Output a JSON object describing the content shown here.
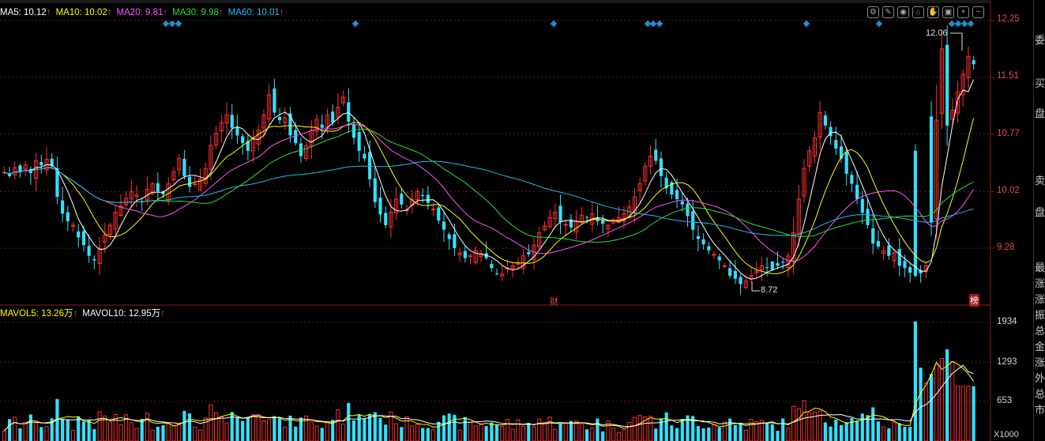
{
  "price_legend": [
    {
      "label": "MA5: 10.12",
      "color": "#ffffff"
    },
    {
      "label": "MA10: 10.02",
      "color": "#ffff00"
    },
    {
      "label": "MA20: 9.81",
      "color": "#ff55ff"
    },
    {
      "label": "MA30: 9.98",
      "color": "#33dd33"
    },
    {
      "label": "MA60: 10.01",
      "color": "#22bbee"
    }
  ],
  "volume_legend": [
    {
      "label": "MAVOL5: 13.26万",
      "color": "#ffff00"
    },
    {
      "label": "MAVOL10: 12.95万",
      "color": "#ffffff"
    }
  ],
  "markers": {
    "high": "12.06",
    "low": "8.72",
    "cai": "财",
    "bang": "榜"
  },
  "volume_unit": "X1000",
  "side_panel_chars": [
    "委",
    "买",
    "盘",
    "卖",
    "盘",
    "最",
    "涨",
    "涨",
    "振",
    "总",
    "金",
    "涨",
    "外",
    "总",
    "市"
  ],
  "toolbar_icons": [
    "settings-icon",
    "pen-icon",
    "eye-icon",
    "home-icon",
    "hand-icon",
    "lock-icon",
    "zoom-in-icon",
    "zoom-out-icon"
  ],
  "colors": {
    "up": "#ff3030",
    "down": "#33e0ff",
    "grid": "#6a1a1a",
    "signal": "#1e90d0"
  },
  "chart_data": {
    "type": "candlestick",
    "y_ticks": [
      "12.25",
      "11.51",
      "10.77",
      "10.02",
      "9.28"
    ],
    "ylim": [
      8.55,
      12.35
    ],
    "volume_ticks": [
      "1934",
      "1293",
      "653"
    ],
    "volume_ylim": [
      0,
      2300
    ],
    "candle_count": 180,
    "closes": [
      10.27,
      10.22,
      10.33,
      10.28,
      10.37,
      10.26,
      10.42,
      10.36,
      10.44,
      10.35,
      9.95,
      9.73,
      9.63,
      9.58,
      9.42,
      9.32,
      9.18,
      9.12,
      9.28,
      9.45,
      9.58,
      9.75,
      9.83,
      9.93,
      10.02,
      9.98,
      9.88,
      10.05,
      10.12,
      10.02,
      9.98,
      10.12,
      10.28,
      10.45,
      10.22,
      10.08,
      10.12,
      10.18,
      10.32,
      10.62,
      10.78,
      10.92,
      11.02,
      10.85,
      10.75,
      10.65,
      10.55,
      10.72,
      10.82,
      11.02,
      11.28,
      11.05,
      10.95,
      10.98,
      10.75,
      10.65,
      10.48,
      10.62,
      10.82,
      10.96,
      10.85,
      11.02,
      10.92,
      11.12,
      11.25,
      10.93,
      10.72,
      10.55,
      10.45,
      10.18,
      9.88,
      9.72,
      9.58,
      9.75,
      9.92,
      9.85,
      9.78,
      9.92,
      10.02,
      9.96,
      9.87,
      9.79,
      9.64,
      9.52,
      9.4,
      9.28,
      9.22,
      9.15,
      9.18,
      9.25,
      9.21,
      9.15,
      9.02,
      8.95,
      8.94,
      9.02,
      9.05,
      9.09,
      9.18,
      9.2,
      9.32,
      9.48,
      9.57,
      9.68,
      9.75,
      9.62,
      9.59,
      9.55,
      9.64,
      9.71,
      9.68,
      9.73,
      9.63,
      9.6,
      9.58,
      9.65,
      9.68,
      9.73,
      9.82,
      9.95,
      10.12,
      10.35,
      10.48,
      10.42,
      10.22,
      10.06,
      9.98,
      9.92,
      9.85,
      9.7,
      9.52,
      9.4,
      9.33,
      9.25,
      9.2,
      9.12,
      9.05,
      8.92,
      8.88,
      8.81,
      8.85,
      8.92,
      8.98,
      9.05,
      9.02,
      9.0,
      9.05,
      9.1,
      9.18,
      9.48,
      9.92,
      10.32,
      10.55,
      10.72,
      11.05,
      10.88,
      10.74,
      10.58,
      10.45,
      10.25,
      10.12,
      9.92,
      9.74,
      9.58,
      9.34,
      9.3,
      9.25,
      9.18,
      9.22,
      9.05,
      9.02,
      8.96,
      8.92,
      8.95,
      9.05,
      9.62,
      10.95,
      11.88,
      10.88,
      11.08,
      11.32,
      11.55,
      11.78,
      11.68
    ],
    "series": [
      {
        "name": "MA5",
        "color": "#ffffff"
      },
      {
        "name": "MA10",
        "color": "#ffff00"
      },
      {
        "name": "MA20",
        "color": "#ff55ff"
      },
      {
        "name": "MA30",
        "color": "#33dd33"
      },
      {
        "name": "MA60",
        "color": "#22bbee"
      }
    ]
  }
}
